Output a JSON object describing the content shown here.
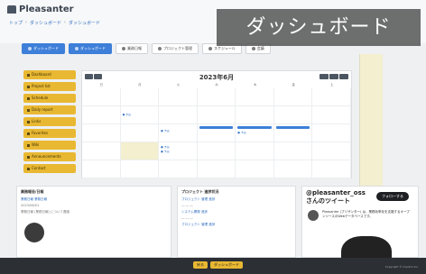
{
  "app": {
    "title": "Pleasanter",
    "banner": "ダッシュボード"
  },
  "breadcrumb": [
    "トップ",
    "ダッシュボード",
    "ダッシュボード"
  ],
  "tabs": [
    {
      "label": "ダッシュボード",
      "active": true
    },
    {
      "label": "ダッシュボード",
      "active": true
    },
    {
      "label": "業務日報",
      "active": false
    },
    {
      "label": "プロジェクト管理",
      "active": false
    },
    {
      "label": "スケジュール",
      "active": false
    },
    {
      "label": "会議",
      "active": false
    }
  ],
  "sidebar": [
    {
      "label": "Dashboard"
    },
    {
      "label": "Project list"
    },
    {
      "label": "Schedule"
    },
    {
      "label": "Daily report"
    },
    {
      "label": "Links"
    },
    {
      "label": "Favorites"
    },
    {
      "label": "Wiki"
    },
    {
      "label": "Announcements"
    },
    {
      "label": "Contact"
    }
  ],
  "calendar": {
    "title": "2023年6月",
    "days": [
      "日",
      "月",
      "火",
      "水",
      "木",
      "金",
      "土"
    ]
  },
  "cards": {
    "news": {
      "title": "業務報告/日報",
      "link": "業務日報 業務日報",
      "meta": "2023/06/01",
      "text": "業務日報 (業務日報) について連絡"
    },
    "projects": {
      "title": "プロジェクト 進捗状況",
      "items": [
        "プロジェクト 管理 進捗",
        "システム開発 進捗",
        "プロジェクト 管理 進捗"
      ]
    },
    "twitter": {
      "title": "@pleasanter_ossさんのツイート",
      "follow": "フォローする",
      "text": "Pleasanter (プリザンター) は、業務効率化を支援するオープンソースのWebデータベースです。"
    }
  },
  "footer": {
    "btn1": "戻る",
    "btn2": "ダッシュボード",
    "copyright": "Copyright © Implem Inc."
  }
}
